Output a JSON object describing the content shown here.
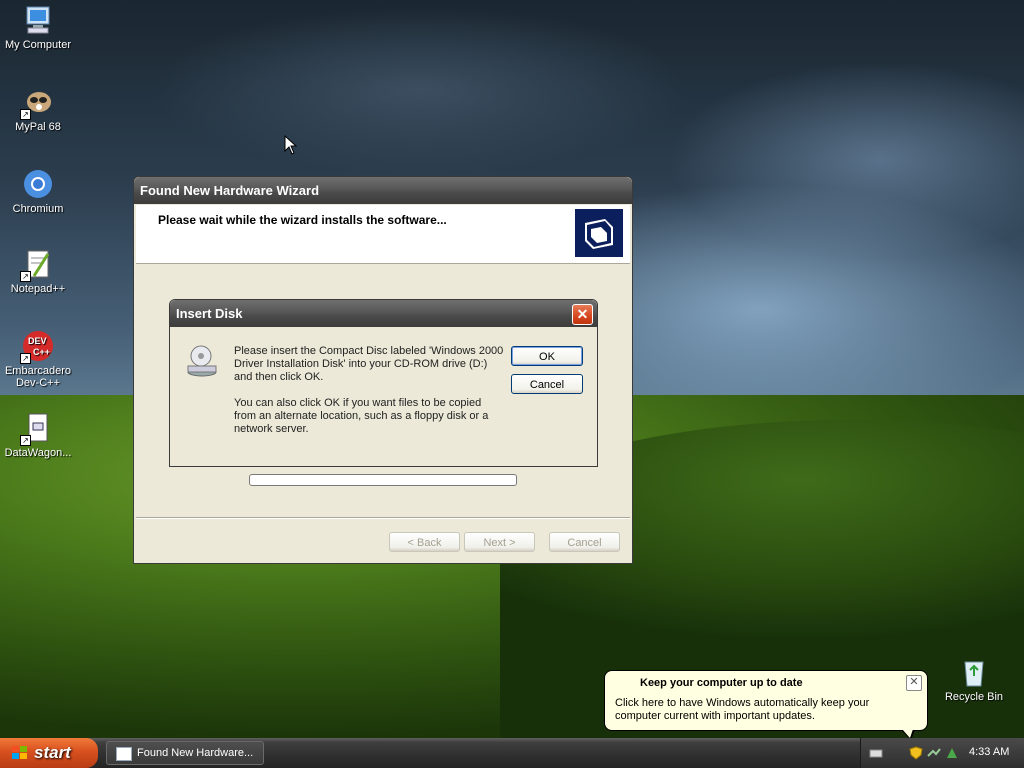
{
  "desktop": {
    "icons": [
      {
        "label": "My Computer"
      },
      {
        "label": "MyPal 68"
      },
      {
        "label": "Chromium"
      },
      {
        "label": "Notepad++"
      },
      {
        "label": "Embarcadero Dev-C++"
      },
      {
        "label": "DataWagon..."
      },
      {
        "label": "Recycle Bin"
      }
    ]
  },
  "wizard": {
    "title": "Found New Hardware Wizard",
    "header_text": "Please wait while the wizard installs the software...",
    "progress": 0,
    "back_label": "< Back",
    "next_label": "Next >",
    "cancel_label": "Cancel"
  },
  "insert_disk": {
    "title": "Insert Disk",
    "message1": "Please insert the Compact Disc labeled 'Windows 2000 Driver Installation Disk' into your CD-ROM drive (D:) and then click OK.",
    "message2": "You can also click OK if you want files to be copied from an alternate location, such as a floppy disk or a network server.",
    "ok_label": "OK",
    "cancel_label": "Cancel"
  },
  "balloon": {
    "title": "Keep your computer up to date",
    "text": "Click here to have Windows automatically keep your computer current with important updates."
  },
  "taskbar": {
    "start_label": "start",
    "task_label": "Found New Hardware...",
    "clock": "4:33 AM"
  }
}
